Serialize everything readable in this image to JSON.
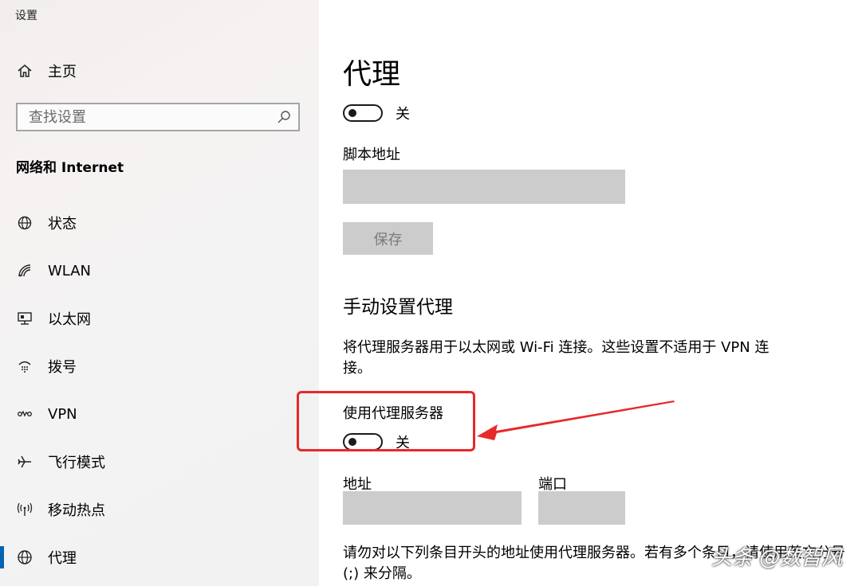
{
  "window": {
    "title": "设置"
  },
  "sidebar": {
    "home_label": "主页",
    "search_placeholder": "查找设置",
    "section_title": "网络和 Internet",
    "items": [
      {
        "label": "状态",
        "icon": "globe-status-icon"
      },
      {
        "label": "WLAN",
        "icon": "wifi-icon"
      },
      {
        "label": "以太网",
        "icon": "ethernet-icon"
      },
      {
        "label": "拨号",
        "icon": "dialup-icon"
      },
      {
        "label": "VPN",
        "icon": "vpn-icon"
      },
      {
        "label": "飞行模式",
        "icon": "airplane-icon"
      },
      {
        "label": "移动热点",
        "icon": "hotspot-icon"
      },
      {
        "label": "代理",
        "icon": "globe-icon",
        "active": true
      }
    ]
  },
  "main": {
    "title": "代理",
    "auto_toggle_state": "关",
    "script_address_label": "脚本地址",
    "script_address_value": "",
    "save_button": "保存",
    "manual_heading": "手动设置代理",
    "manual_description": "将代理服务器用于以太网或 Wi-Fi 连接。这些设置不适用于 VPN 连接。",
    "use_proxy_label": "使用代理服务器",
    "use_proxy_state": "关",
    "address_label": "地址",
    "address_value": "",
    "port_label": "端口",
    "port_value": "",
    "exceptions_text": "请勿对以下列条目开头的地址使用代理服务器。若有多个条目，请使用英文分号 (;) 来分隔。"
  },
  "watermark": "头条 @数智风",
  "colors": {
    "accent": "#0063b1",
    "annotation_red": "#e8282b",
    "field_gray": "#cccccc"
  }
}
